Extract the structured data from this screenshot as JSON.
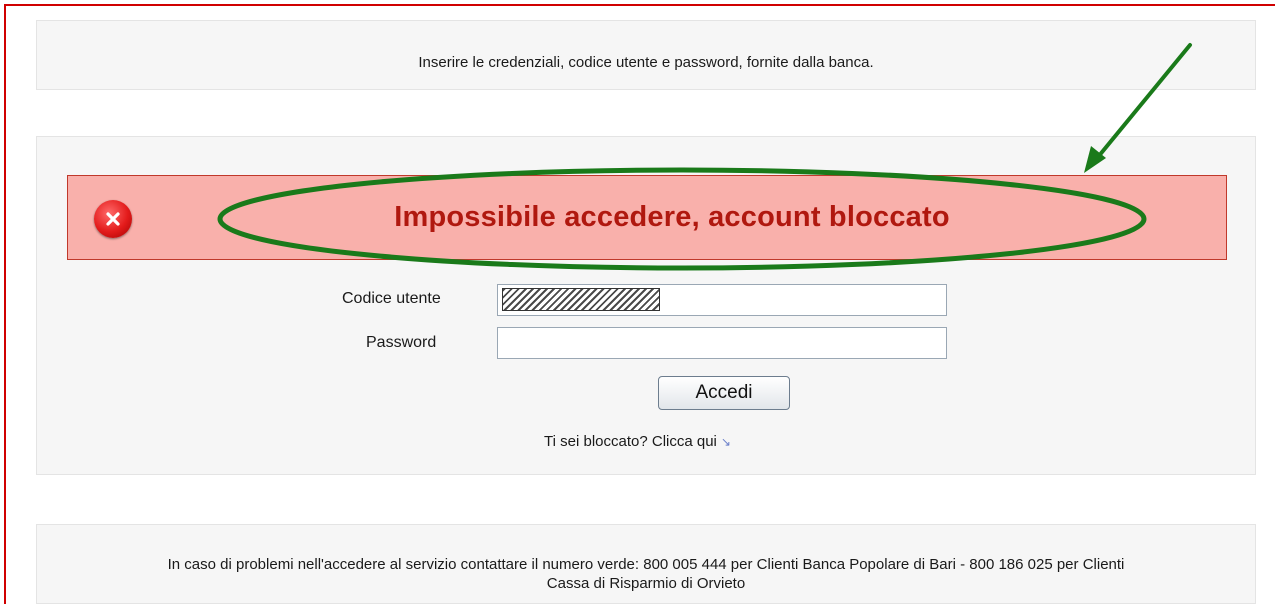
{
  "info": {
    "text": "Inserire le credenziali, codice utente e password, fornite dalla banca."
  },
  "error": {
    "icon": "error-x-icon",
    "message": "Impossibile accedere, account bloccato"
  },
  "form": {
    "user_label": "Codice utente",
    "password_label": "Password",
    "user_value": "",
    "password_value": "",
    "submit_label": "Accedi"
  },
  "blocked": {
    "link_text": "Ti sei bloccato? Clicca qui",
    "arrow_icon": "link-arrow-icon"
  },
  "help": {
    "text": "In caso di problemi nell'accedere al servizio contattare il numero verde: 800 005 444 per Clienti Banca Popolare di Bari - 800 186 025 per Clienti Cassa di Risparmio di Orvieto"
  },
  "colors": {
    "error_background": "#f9b0ab",
    "error_text": "#b0180f",
    "annotation": "#1a7a1a",
    "frame": "#d00000"
  }
}
